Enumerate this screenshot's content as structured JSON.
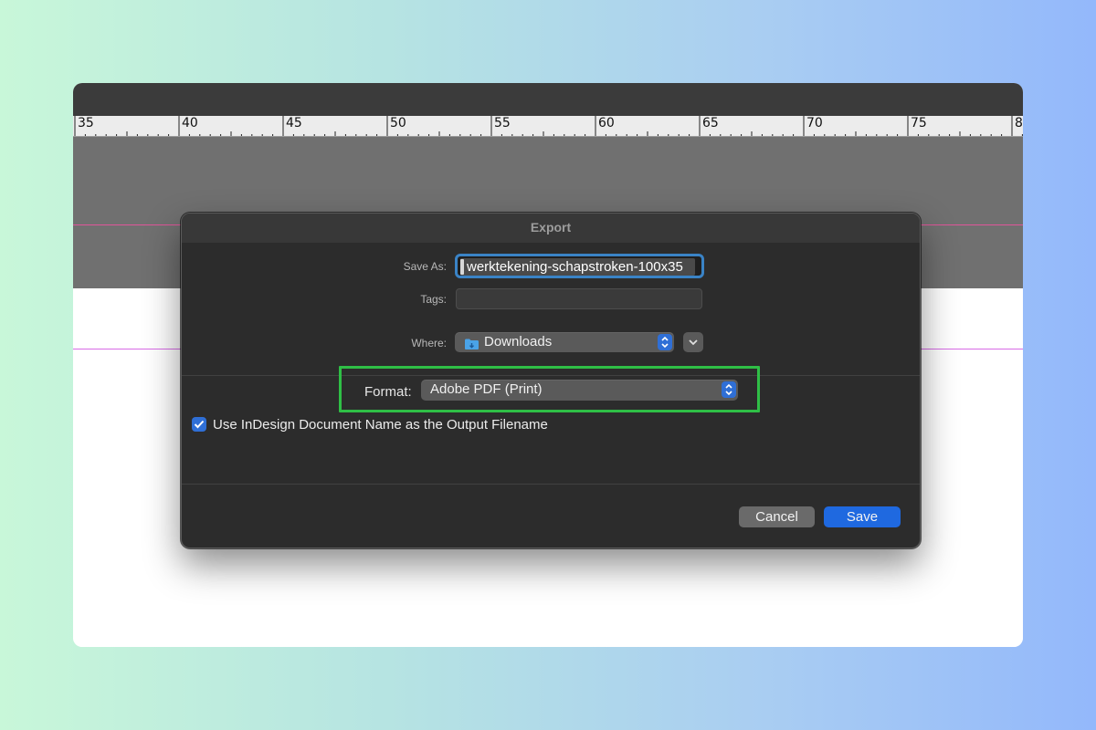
{
  "ruler": {
    "numbers": [
      "35",
      "40",
      "45",
      "50",
      "55",
      "60",
      "65",
      "70",
      "75",
      "8"
    ]
  },
  "dialog": {
    "title": "Export",
    "save_as": {
      "label": "Save As:",
      "value": "werktekening-schapstroken-100x35"
    },
    "tags": {
      "label": "Tags:",
      "value": ""
    },
    "where": {
      "label": "Where:",
      "value": "Downloads"
    },
    "format": {
      "label": "Format:",
      "value": "Adobe PDF (Print)"
    },
    "checkbox": {
      "label": "Use InDesign Document Name as the Output Filename",
      "checked": true
    },
    "buttons": {
      "cancel": "Cancel",
      "save": "Save"
    }
  },
  "colors": {
    "accent": "#1f69e0",
    "highlight": "#2fbf46",
    "dialog_bg": "#2c2c2c"
  },
  "icons": {
    "folder": "downloads-folder-icon",
    "stepper": "up-down-chevron-icon",
    "expand": "chevron-down-icon",
    "check": "checkmark-icon"
  }
}
